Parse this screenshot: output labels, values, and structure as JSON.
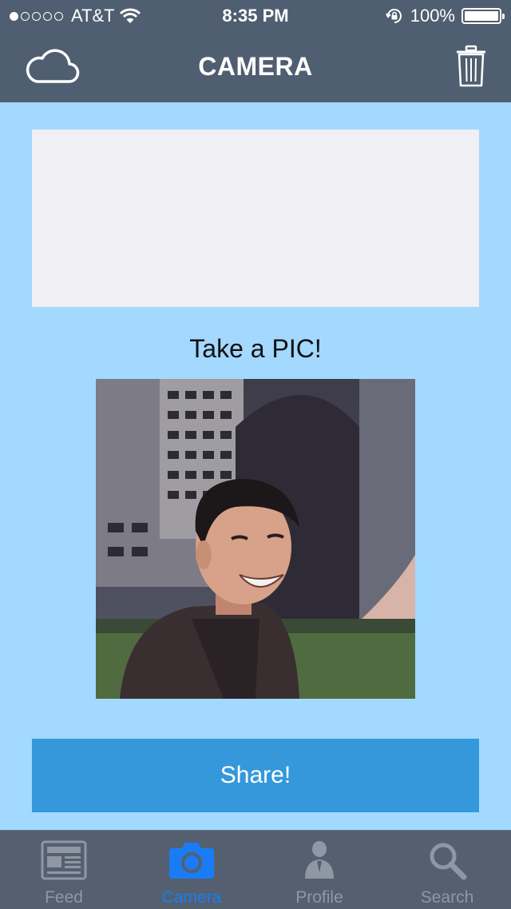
{
  "status_bar": {
    "carrier": "AT&T",
    "signal_bars_filled": 1,
    "signal_bars_total": 5,
    "time": "8:35 PM",
    "battery": "100%",
    "battery_level": 1.0
  },
  "navbar": {
    "title": "CAMERA",
    "left_icon": "cloud-icon",
    "right_icon": "trash-icon"
  },
  "main": {
    "prompt": "Take a PIC!",
    "share_label": "Share!"
  },
  "tabs": [
    {
      "label": "Feed",
      "icon": "newspaper-icon",
      "active": false
    },
    {
      "label": "Camera",
      "icon": "camera-icon",
      "active": true
    },
    {
      "label": "Profile",
      "icon": "person-icon",
      "active": false
    },
    {
      "label": "Search",
      "icon": "search-icon",
      "active": false
    }
  ],
  "colors": {
    "background": "#a3d8ff",
    "bar": "#4f5e70",
    "share_button": "#3498db",
    "tab_active": "#1a7cf5",
    "tab_inactive": "#8e97a3"
  }
}
